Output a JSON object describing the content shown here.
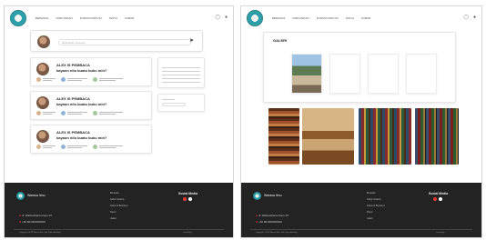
{
  "nav": {
    "items": [
      "BERANDA",
      "DISKUSIKAN",
      "FORUM DISKUSI",
      "TANYA",
      "KABAR"
    ],
    "icons": [
      "bell-icon",
      "user-icon"
    ]
  },
  "forum": {
    "composer_placeholder": "diskusikan sesuatu...",
    "posts": [
      {
        "title": "ALEX IS PEMBACA",
        "question": "kayaon nilo buatu buku min?"
      },
      {
        "title": "ALEX IS PEMBACA",
        "question": "kayaon nilo buatu buku min?"
      },
      {
        "title": "ALEX IS PEMBACA",
        "question": "kayaon nilo buatu buku min?"
      }
    ]
  },
  "galeri": {
    "title": "GALERI"
  },
  "footer": {
    "brand": "Warasa Ilmu",
    "address": "Jl. Walzocibarzu Kam 15",
    "phone": "+62 821000000002",
    "links": [
      "Beranda",
      "Kabar Galeria",
      "Kabar & Berkaryo",
      "Pavor",
      "Galeri"
    ],
    "social_title": "Social Media",
    "copyright": "Copyright ©2023 Warasa Ilmu. Hak Cipta dilindungi",
    "credit": "created by ..."
  },
  "colors": {
    "footer_bg": "#232323",
    "accent": "#2c9fa8"
  }
}
